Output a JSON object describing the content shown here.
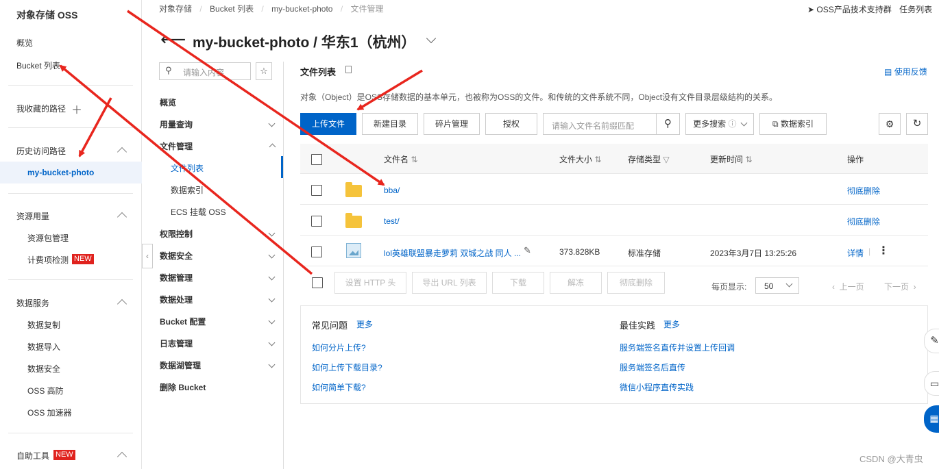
{
  "breadcrumb": [
    "对象存储",
    "Bucket 列表",
    "my-bucket-photo",
    "文件管理"
  ],
  "top_right": {
    "group": "OSS产品技术支持群",
    "tasks": "任务列表"
  },
  "page_title": "my-bucket-photo / 华东1（杭州）",
  "leftnav": {
    "title": "对象存储 OSS",
    "overview": "概览",
    "bucket_list": "Bucket 列表",
    "favorites": "我收藏的路径",
    "history": "历史访问路径",
    "history_item": "my-bucket-photo",
    "resources": "资源用量",
    "resources_items": [
      "资源包管理",
      "计费项检测"
    ],
    "new_badge": "NEW",
    "data_service": "数据服务",
    "data_service_items": [
      "数据复制",
      "数据导入",
      "数据安全",
      "OSS 高防",
      "OSS 加速器"
    ],
    "self_tools": "自助工具"
  },
  "col2": {
    "search_placeholder": "请输入内容",
    "items": [
      "概览",
      "用量查询",
      "文件管理",
      "权限控制",
      "数据安全",
      "数据管理",
      "数据处理",
      "Bucket 配置",
      "日志管理",
      "数据湖管理",
      "删除 Bucket"
    ],
    "file_sub": [
      "文件列表",
      "数据索引",
      "ECS 挂载 OSS"
    ]
  },
  "main": {
    "section_title": "文件列表",
    "feedback": "使用反馈",
    "description": "对象（Object）是OSS存储数据的基本单元，也被称为OSS的文件。和传统的文件系统不同，Object没有文件目录层级结构的关系。",
    "toolbar": {
      "upload": "上传文件",
      "new_dir": "新建目录",
      "fragments": "碎片管理",
      "authorize": "授权",
      "search_placeholder": "请输入文件名前缀匹配",
      "more_search": "更多搜索",
      "data_index": "数据索引"
    },
    "table": {
      "headers": [
        "文件名",
        "文件大小",
        "存储类型",
        "更新时间",
        "操作"
      ],
      "rows": [
        {
          "name": "bba/",
          "size": "",
          "type": "",
          "time": "",
          "action": "彻底删除"
        },
        {
          "name": "test/",
          "size": "",
          "type": "",
          "time": "",
          "action": "彻底删除"
        },
        {
          "name": "lol英雄联盟暴走萝莉 双城之战 同人 ...",
          "size": "373.828KB",
          "type": "标准存储",
          "time": "2023年3月7日 13:25:26",
          "action": "详情"
        }
      ]
    },
    "footer": {
      "set_http": "设置 HTTP 头",
      "export_url": "导出 URL 列表",
      "download": "下载",
      "unfreeze": "解冻",
      "delete": "彻底删除",
      "per_page_label": "每页显示:",
      "per_page": "50",
      "prev": "上一页",
      "next": "下一页"
    },
    "faq": {
      "title": "常见问题",
      "more": "更多",
      "items": [
        "如何分片上传?",
        "如何上传下载目录?",
        "如何简单下载?"
      ]
    },
    "best": {
      "title": "最佳实践",
      "more": "更多",
      "items": [
        "服务端签名直传并设置上传回调",
        "服务端签名后直传",
        "微信小程序直传实践"
      ]
    }
  },
  "watermark": "CSDN @大青虫",
  "colors": {
    "primary": "#0064c8",
    "arrow": "#e8261e",
    "folder": "#f5c33b",
    "new_badge": "#e0221e"
  }
}
